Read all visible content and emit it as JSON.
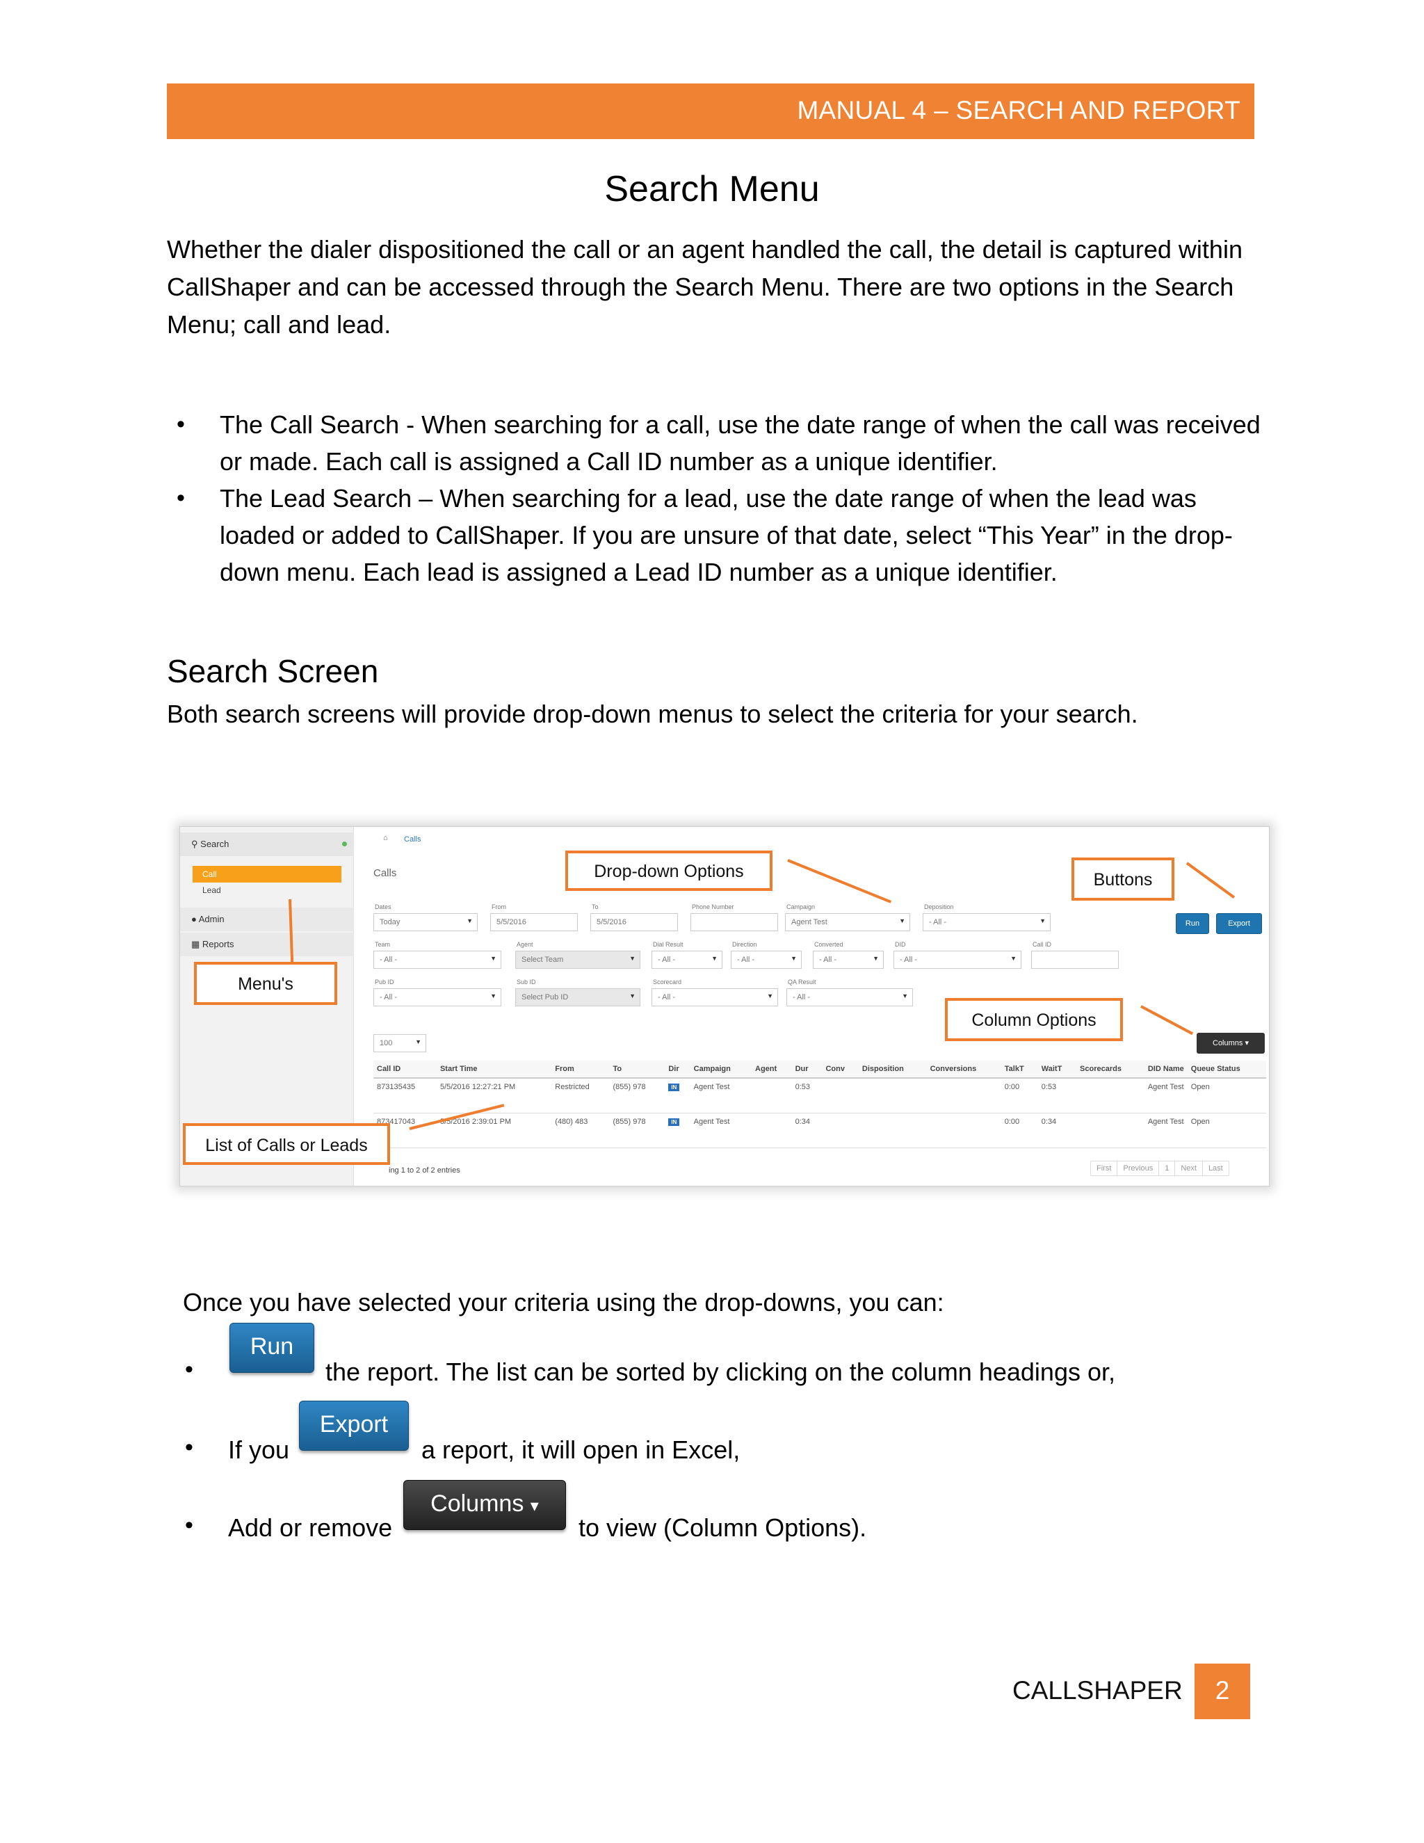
{
  "header": {
    "title": "MANUAL 4 – SEARCH AND REPORT"
  },
  "page_title": "Search Menu",
  "intro": "Whether the dialer dispositioned the call or an agent handled the call, the detail is captured within CallShaper and can be accessed through the Search Menu.  There are two options in the Search Menu; call and lead.",
  "bullets": [
    "The Call Search - When searching for a call, use the date range of when the call was received or made.  Each call is assigned a Call ID number as a unique identifier.",
    "The Lead Search – When searching for a lead, use the date range of when the lead was loaded or added to CallShaper.  If you are unsure of that date, select “This Year” in the drop-down menu.  Each lead is assigned a Lead ID number as a unique identifier."
  ],
  "section": {
    "heading": "Search Screen",
    "desc": "Both search screens will provide drop-down menus to select the criteria for your search."
  },
  "screenshot": {
    "sidebar": {
      "search": "Search",
      "call": "Call",
      "lead": "Lead",
      "admin": "Admin",
      "reports": "Reports"
    },
    "breadcrumb": "Calls",
    "heading": "Calls",
    "labels": {
      "dates": "Dates",
      "from": "From",
      "to": "To",
      "phone": "Phone Number",
      "campaign": "Campaign",
      "deposition": "Deposition",
      "team": "Team",
      "agent": "Agent",
      "dial_result": "Dial Result",
      "direction": "Direction",
      "converted": "Converted",
      "did": "DID",
      "call_id": "Call ID",
      "pub_id": "Pub ID",
      "sub_id": "Sub ID",
      "scorecard": "Scorecard",
      "qa_result": "QA Result"
    },
    "values": {
      "dates": "Today",
      "from": "5/5/2016",
      "to": "5/5/2016",
      "campaign": "Agent Test",
      "all": "- All -",
      "select_team": "Select Team",
      "select_pub": "Select Pub ID",
      "page_size": "100"
    },
    "buttons": {
      "run": "Run",
      "export": "Export",
      "columns": "Columns"
    },
    "table": {
      "headers": [
        "Call ID",
        "Start Time",
        "From",
        "To",
        "Dir",
        "Campaign",
        "Agent",
        "Dur",
        "Conv",
        "Disposition",
        "Conversions",
        "TalkT",
        "WaitT",
        "Scorecards",
        "DID Name",
        "Queue Status"
      ],
      "rows": [
        [
          "873135435",
          "5/5/2016 12:27:21 PM",
          "Restricted",
          "(855) 978",
          "IN",
          "Agent Test",
          "",
          "0:53",
          "",
          "",
          "",
          "0:00",
          "0:53",
          "",
          "Agent Test",
          "Open"
        ],
        [
          "873417043",
          "5/5/2016 2:39:01 PM",
          "(480) 483",
          "(855) 978",
          "IN",
          "Agent Test",
          "",
          "0:34",
          "",
          "",
          "",
          "0:00",
          "0:34",
          "",
          "Agent Test",
          "Open"
        ]
      ]
    },
    "showing": "ing 1 to 2 of 2 entries",
    "pager": [
      "First",
      "Previous",
      "1",
      "Next",
      "Last"
    ],
    "callouts": {
      "dropdown": "Drop-down Options",
      "buttons": "Buttons",
      "menus": "Menu's",
      "columns": "Column Options",
      "list": "List of Calls or Leads"
    }
  },
  "after": {
    "intro": "Once you have selected your criteria using the drop-downs, you can:",
    "run_label": "Run",
    "run_text": "the report.  The list can be sorted by clicking on the column headings or,",
    "export_prefix": "If you",
    "export_label": "Export",
    "export_text": "a report, it will open in Excel,",
    "columns_prefix": "Add or remove",
    "columns_label": "Columns",
    "columns_text": "to view (Column Options)."
  },
  "footer": {
    "brand": "CALLSHAPER",
    "page": "2"
  }
}
